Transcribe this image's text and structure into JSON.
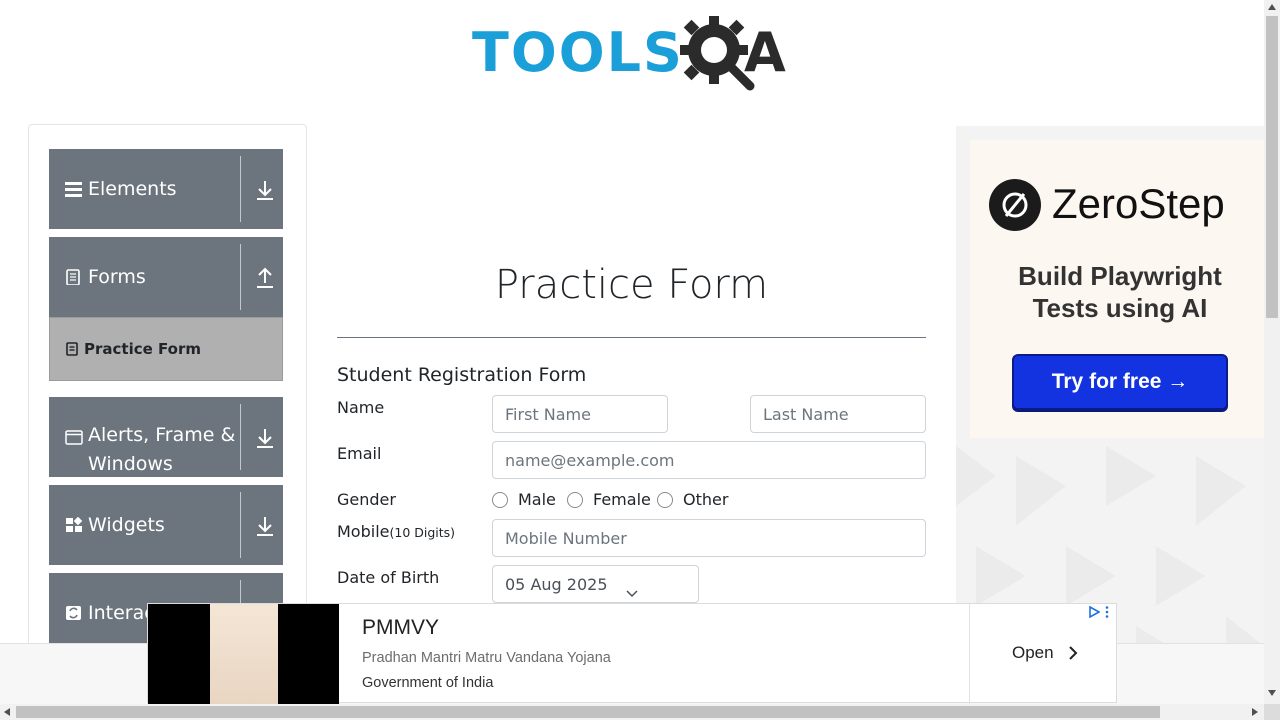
{
  "header": {
    "logo_text": "TOOLS",
    "logo_suffix": "A"
  },
  "sidebar": {
    "groups": [
      {
        "label": "Elements",
        "icon": "hamburger-icon",
        "arrow": "download-arrow-icon"
      },
      {
        "label": "Forms",
        "icon": "document-icon",
        "arrow": "upload-arrow-icon"
      },
      {
        "label": "Alerts, Frame &\nWindows",
        "label_line1": "Alerts, Frame &",
        "label_line2": "Windows",
        "icon": "window-icon",
        "arrow": "download-arrow-icon"
      },
      {
        "label": "Widgets",
        "icon": "widgets-icon",
        "arrow": "download-arrow-icon"
      },
      {
        "label": "Interac",
        "icon": "interactions-icon",
        "arrow": "download-arrow-icon"
      }
    ],
    "active_item": {
      "label": "Practice Form",
      "icon": "form-icon"
    }
  },
  "main": {
    "page_title": "Practice Form",
    "form_title": "Student Registration Form",
    "name_label": "Name",
    "first_name_placeholder": "First Name",
    "last_name_placeholder": "Last Name",
    "email_label": "Email",
    "email_placeholder": "name@example.com",
    "gender_label": "Gender",
    "gender_options": [
      "Male",
      "Female",
      "Other"
    ],
    "mobile_label": "Mobile",
    "mobile_hint": "(10 Digits)",
    "mobile_placeholder": "Mobile Number",
    "dob_label": "Date of Birth",
    "dob_value": "05 Aug 2025"
  },
  "ad_right": {
    "brand": "ZeroStep",
    "tagline_line1": "Build Playwright",
    "tagline_line2": "Tests using AI",
    "cta": "Try for free →",
    "colors": {
      "cta_bg": "#1433e0",
      "card_bg": "#fcf7f1"
    }
  },
  "bottom_ad": {
    "title": "PMMVY",
    "subtitle": "Pradhan Mantri Matru Vandana Yojana",
    "source": "Government of India",
    "cta": "Open"
  },
  "colors": {
    "sidebar_group_bg": "#6c757d",
    "active_item_bg": "#b0b0b0",
    "logo_blue": "#1a9fd9",
    "logo_dark": "#2b2b2b"
  }
}
